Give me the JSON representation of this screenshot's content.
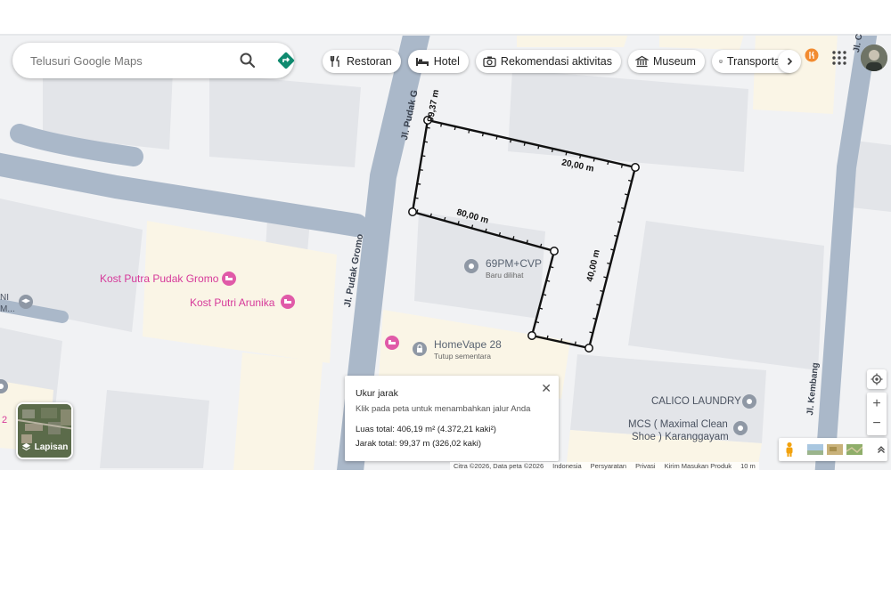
{
  "search": {
    "placeholder": "Telusuri Google Maps"
  },
  "chips": [
    {
      "label": "Restoran",
      "icon": "fork-knife-icon"
    },
    {
      "label": "Hotel",
      "icon": "bed-icon"
    },
    {
      "label": "Rekomendasi aktivitas",
      "icon": "camera-icon"
    },
    {
      "label": "Museum",
      "icon": "museum-icon"
    },
    {
      "label": "Transportasi",
      "icon": "bus-icon"
    }
  ],
  "places": {
    "kost_pudak": "Kost Putra Pudak Gromo",
    "kost_arunika": "Kost Putri Arunika",
    "pluscode": "69PM+CVP",
    "pluscode_sub": "Baru dilihat",
    "homevape": "HomeVape 28",
    "homevape_sub": "Tutup sementara",
    "calico": "CALICO LAUNDRY",
    "mcs_line1": "MCS ( Maximal Clean",
    "mcs_line2": "Shoe ) Karanggayam",
    "partial_left1": "NI",
    "partial_left2": "M...",
    "partial_left3": "2"
  },
  "streets": {
    "pudak_gromo_bottom": "Jl. Pudak Gromo",
    "pudak_gromo_top": "Jl. Pudak G",
    "kembang": "Jl. Kembang",
    "top_right": "Jl. Cin"
  },
  "measure": {
    "seg_top_left": "99,37 m",
    "seg_top": "20,00 m",
    "seg_middle": "80,00 m",
    "seg_right": "40,00 m"
  },
  "popup": {
    "title": "Ukur jarak",
    "hint": "Klik pada peta untuk menambahkan jalur Anda",
    "area": "Luas total: 406,19 m² (4.372,21 kaki²)",
    "distance": "Jarak total: 99,37 m (326,02 kaki)"
  },
  "layers": {
    "label": "Lapisan"
  },
  "footer": [
    "Citra ©2026, Data peta ©2026",
    "Indonesia",
    "Persyaratan",
    "Privasi",
    "Kirim Masukan Produk",
    "10 m"
  ],
  "colors": {
    "road": "#aab8c9",
    "building": "#e1e3e7",
    "poi_pink": "#d6399a",
    "accent": "#1a73e8"
  }
}
